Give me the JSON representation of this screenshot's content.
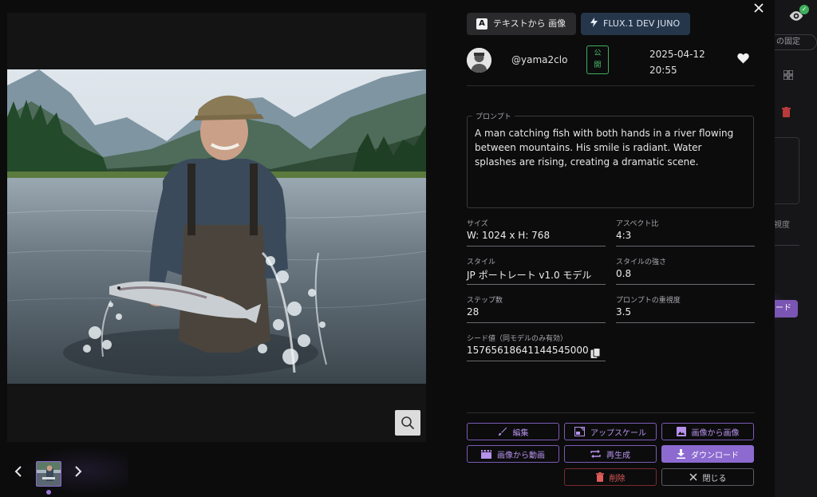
{
  "background": {
    "pin_label": "の固定",
    "field_label": "視度",
    "button_label": "ード"
  },
  "header": {
    "mode_chip": "テキストから 画像",
    "mode_chip_badge": "A",
    "model_chip": "FLUX.1 DEV JUNO"
  },
  "author": {
    "username": "@yama2clo",
    "visibility": "公\n開",
    "date": "2025-04-12\n20:55"
  },
  "prompt": {
    "label": "プロンプト",
    "text": "A man catching fish with both hands in a river flowing between mountains. His smile is radiant. Water splashes are rising, creating a dramatic scene."
  },
  "fields": {
    "size": {
      "label": "サイズ",
      "value": "W: 1024  x  H: 768"
    },
    "aspect": {
      "label": "アスペクト比",
      "value": "4:3"
    },
    "style": {
      "label": "スタイル",
      "value": "JP ポートレート v1.0 モデル"
    },
    "style_strength": {
      "label": "スタイルの強さ",
      "value": "0.8"
    },
    "steps": {
      "label": "ステップ数",
      "value": "28"
    },
    "guidance": {
      "label": "プロンプトの重視度",
      "value": "3.5"
    },
    "seed": {
      "label": "シード値（同モデルのみ有効）",
      "value": "15765618641144545000"
    }
  },
  "actions": {
    "edit": "編集",
    "upscale": "アップスケール",
    "img2img": "画像から画像",
    "img2video": "画像から動画",
    "regenerate": "再生成",
    "download": "ダウンロード",
    "delete": "削除",
    "close": "閉じる"
  },
  "colors": {
    "accent": "#8c6ad0",
    "public": "#4cc36a",
    "danger": "#e05a5a"
  }
}
